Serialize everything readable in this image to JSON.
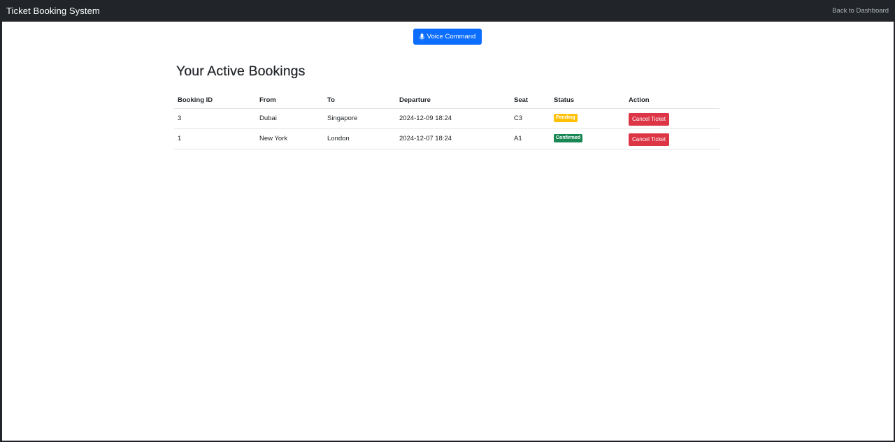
{
  "navbar": {
    "brand": "Ticket Booking System",
    "back_link": "Back to Dashboard"
  },
  "toolbar": {
    "voice_label": "Voice Command",
    "voice_icon": "microphone-icon",
    "voice_color": "#0d6efd"
  },
  "main": {
    "title": "Your Active Bookings"
  },
  "table": {
    "headers": [
      "Booking ID",
      "From",
      "To",
      "Departure",
      "Seat",
      "Status",
      "Action"
    ],
    "rows": [
      {
        "booking_id": "3",
        "from": "Dubai",
        "to": "Singapore",
        "departure": "2024-12-09 18:24",
        "seat": "C3",
        "status": "Pending",
        "status_color": "#ffc107",
        "action": "Cancel Ticket"
      },
      {
        "booking_id": "1",
        "from": "New York",
        "to": "London",
        "departure": "2024-12-07 18:24",
        "seat": "A1",
        "status": "Confirmed",
        "status_color": "#198754",
        "action": "Cancel Ticket"
      }
    ]
  },
  "colors": {
    "navbar_bg": "#212529",
    "danger": "#dc3545",
    "primary": "#0d6efd"
  }
}
